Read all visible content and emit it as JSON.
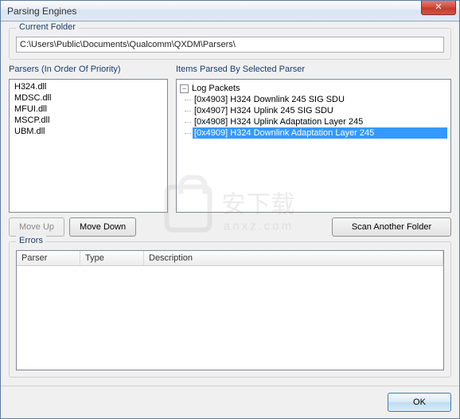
{
  "window": {
    "title": "Parsing Engines",
    "close_glyph": "✕"
  },
  "folder": {
    "group_label": "Current Folder",
    "path": "C:\\Users\\Public\\Documents\\Qualcomm\\QXDM\\Parsers\\"
  },
  "parsers": {
    "label": "Parsers (In Order Of Priority)",
    "items": [
      "H324.dll",
      "MDSC.dll",
      "MFUI.dll",
      "MSCP.dll",
      "UBM.dll"
    ]
  },
  "tree": {
    "label": "Items Parsed By Selected Parser",
    "root_label": "Log Packets",
    "expander_glyph": "−",
    "items": [
      {
        "text": "[0x4903] H324 Downlink 245 SIG SDU",
        "selected": false
      },
      {
        "text": "[0x4907] H324 Uplink 245 SIG SDU",
        "selected": false
      },
      {
        "text": "[0x4908] H324 Uplink Adaptation Layer 245",
        "selected": false
      },
      {
        "text": "[0x4909] H324 Downlink Adaptation Layer 245",
        "selected": true
      }
    ]
  },
  "buttons": {
    "move_up": "Move Up",
    "move_down": "Move Down",
    "scan": "Scan Another Folder",
    "ok": "OK"
  },
  "errors": {
    "group_label": "Errors",
    "columns": {
      "parser": "Parser",
      "type": "Type",
      "desc": "Description"
    }
  },
  "watermark": {
    "text": "安下载",
    "sub": "anxz.com"
  }
}
